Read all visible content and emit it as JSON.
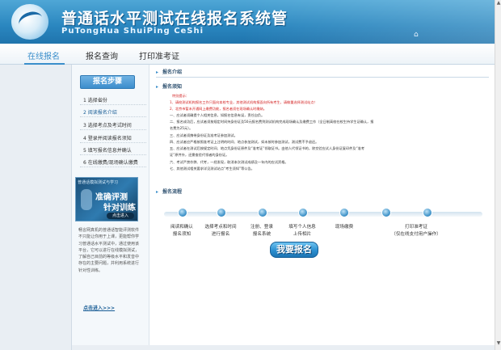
{
  "header": {
    "title": "普通话水平测试在线报名系统管",
    "subtitle": "PuTongHua ShuiPing CeShi",
    "cursor_glyph": "⌂"
  },
  "nav": {
    "tabs": [
      {
        "label": "在线报名",
        "active": true
      },
      {
        "label": "报名查询",
        "active": false
      },
      {
        "label": "打印准考证",
        "active": false
      }
    ],
    "accent_color": "#3b8fcb"
  },
  "sidebar": {
    "title": "报名步骤",
    "steps": [
      "1 选择省份",
      "2 阅读报名介绍",
      "3 选择考点及考试时间",
      "4 登录并阅读报名须知",
      "5 填写报名信息并确认",
      "6 在线缴费/现场确认缴费"
    ],
    "promo": {
      "top": "普通话模拟测试与学习",
      "line1": "准确评测",
      "line2": "针对训练",
      "button": "点击进入"
    },
    "promo_desc": "畅言网真机的普通话智能评测软件不只能让你用于上课，更能帮你学习普通话水平测试中，通过使用该平台，它可以进行在线模拟测试，了解自己目前的等级水平和发音中存在的主要问题，并利用系统进行针对性训练。",
    "more_link": "点击进入>>>"
  },
  "main": {
    "intro_header": "报名介绍",
    "notice_header": "报名须知",
    "notice_lines": [
      "特别提示：",
      "1、请校测试机构报名工作只面向本校专业，其他测试机构报面向所有考生，请做重选择测试站点！",
      "2、北京市暂未开通网上缴费功能，报名者须在现场确认时缴纳。",
      "一、应试者须确提个人相关信息，如报名信息有误，责任自负。",
      "二、报名成功后，应试者须按规定时间持身份证及50元报名费到测试机构完成现场确认及缴费工作（全日制高校在校生持学生证确认，报",
      "名费为25元）。",
      "三、应试者须携带身份证及准考证参加测试。",
      "四、应试者应严格按照准考证上注明的时间、地点参加测试，如未按时参加测试，测试费不予退还。",
      "五、应试者在测试后按规定时间、地点凭身份证原件及“准考证”领取证书。由他人代领证书的，除交验应试人身份证复印件及“准考",
      "证”原件外，还需查验代领者的身份证。",
      "六、考试严禁作弊、代考，一经发现，取消本次测试成绩及一年内的应试资格。",
      "七、其他测试相关要求详见测试站点“考生须知”等公告。"
    ],
    "flow_header": "报名流程",
    "flow_steps": [
      [
        "阅读和确认",
        "报名须知"
      ],
      [
        "选择考点和时间",
        "进行报名"
      ],
      [
        "注册、登录",
        "报名系统"
      ],
      [
        "填写个人信息",
        "上传相片"
      ],
      [
        "现场缴费"
      ],
      [
        "打印准考证",
        "（仅在线支付用户操作）"
      ]
    ],
    "register_button": "我要报名"
  }
}
